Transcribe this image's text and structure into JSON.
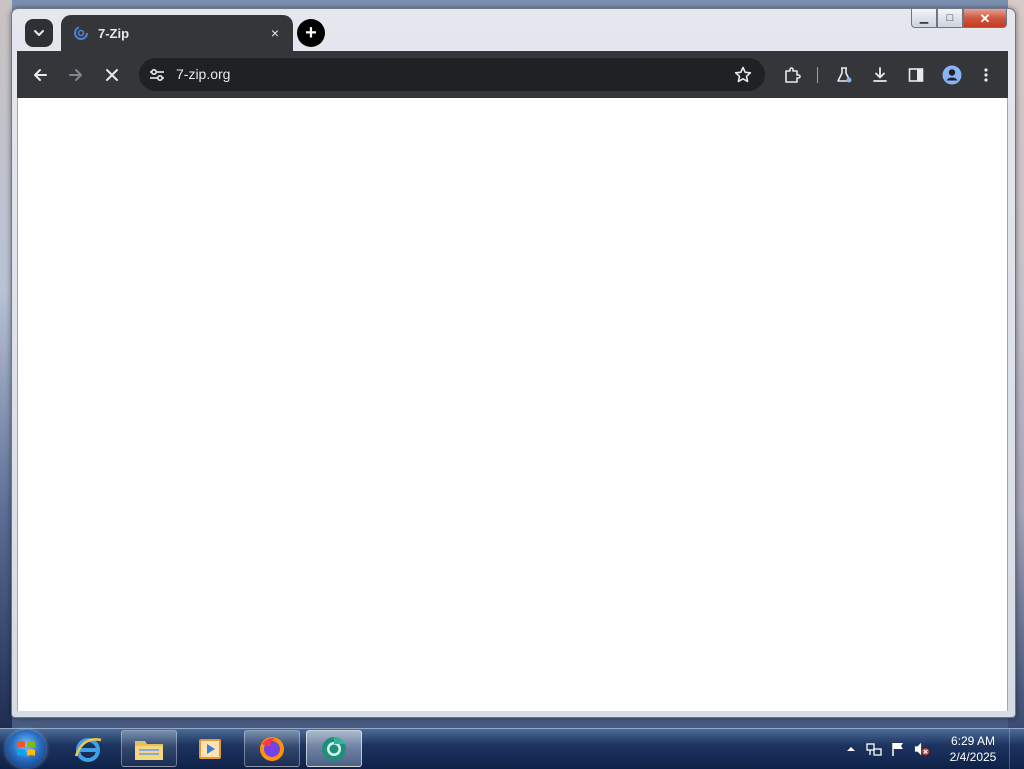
{
  "browser": {
    "tab": {
      "title": "7-Zip",
      "close_glyph": "×"
    },
    "new_tab_glyph": "+",
    "address": {
      "url": "7-zip.org"
    },
    "nav": {
      "back_icon": "arrow-left-icon",
      "forward_icon": "arrow-right-icon",
      "stop_icon": "close-icon"
    },
    "toolbar_icons": [
      "extensions-icon",
      "labs-icon",
      "download-icon",
      "side-panel-icon",
      "profile-icon",
      "menu-icon"
    ]
  },
  "window": {
    "caption": {
      "minimize": "▁",
      "maximize": "□",
      "close": "✕"
    }
  },
  "taskbar": {
    "apps": [
      "internet-explorer",
      "file-explorer",
      "media-player",
      "firefox",
      "chrome"
    ],
    "clock": {
      "time": "6:29 AM",
      "date": "2/4/2025"
    }
  },
  "colors": {
    "tab_bg": "#35363a",
    "omnibox_bg": "#202124",
    "text_light": "#e8eaed"
  }
}
